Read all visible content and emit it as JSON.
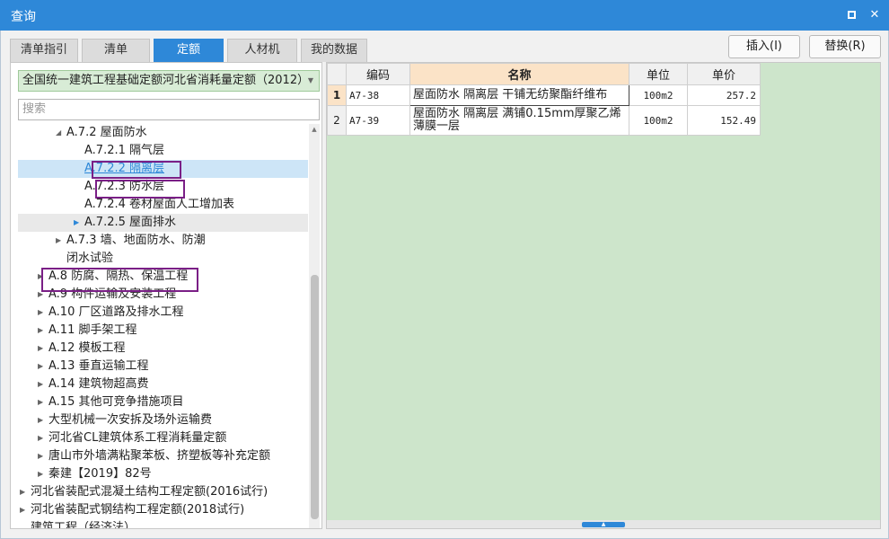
{
  "window": {
    "title": "查询",
    "max_glyph": "□",
    "close_glyph": "✕"
  },
  "tabs": [
    {
      "label": "清单指引"
    },
    {
      "label": "清单"
    },
    {
      "label": "定额",
      "active": true
    },
    {
      "label": "人材机"
    },
    {
      "label": "我的数据"
    }
  ],
  "actions": {
    "insert_label": "插入(I)",
    "replace_label": "替换(R)"
  },
  "left": {
    "library_selected": "全国统一建筑工程基础定额河北省消耗量定额（2012）",
    "search_placeholder": "搜索"
  },
  "tree": [
    {
      "label": "A.7.2 屋面防水",
      "arrow": "◢"
    },
    {
      "label": "A.7.2.1 隔气层",
      "arrow": ""
    },
    {
      "label": "A.7.2.2 隔离层",
      "arrow": "",
      "selected": true
    },
    {
      "label": "A.7.2.3 防水层",
      "arrow": ""
    },
    {
      "label": "A.7.2.4 卷材屋面人工增加表",
      "arrow": ""
    },
    {
      "label": "A.7.2.5 屋面排水",
      "arrow": "▶"
    },
    {
      "label": "A.7.3 墙、地面防水、防潮",
      "arrow": "▶"
    },
    {
      "label": "闭水试验",
      "arrow": ""
    },
    {
      "label": "A.8 防腐、隔热、保温工程",
      "arrow": "▶"
    },
    {
      "label": "A.9 构件运输及安装工程",
      "arrow": "▶"
    },
    {
      "label": "A.10 厂区道路及排水工程",
      "arrow": "▶"
    },
    {
      "label": "A.11 脚手架工程",
      "arrow": "▶"
    },
    {
      "label": "A.12 模板工程",
      "arrow": "▶"
    },
    {
      "label": "A.13 垂直运输工程",
      "arrow": "▶"
    },
    {
      "label": "A.14 建筑物超高费",
      "arrow": "▶"
    },
    {
      "label": "A.15 其他可竞争措施项目",
      "arrow": "▶"
    },
    {
      "label": "大型机械一次安拆及场外运输费",
      "arrow": "▶"
    },
    {
      "label": "河北省CL建筑体系工程消耗量定额",
      "arrow": "▶"
    },
    {
      "label": "唐山市外墙满粘聚苯板、挤塑板等补充定额",
      "arrow": "▶"
    },
    {
      "label": "秦建【2019】82号",
      "arrow": "▶"
    },
    {
      "label": "河北省装配式混凝土结构工程定额(2016试行)",
      "arrow": "▶"
    },
    {
      "label": "河北省装配式钢结构工程定额(2018试行)",
      "arrow": "▶"
    },
    {
      "label": "建筑工程（经济法）",
      "arrow": ""
    }
  ],
  "grid": {
    "headers": {
      "code": "编码",
      "name": "名称",
      "unit": "单位",
      "price": "单价"
    },
    "rows": [
      {
        "num": "1",
        "code": "A7-38",
        "name": "屋面防水 隔离层 干铺无纺聚酯纤维布",
        "unit": "100m2",
        "price": "257.2"
      },
      {
        "num": "2",
        "code": "A7-39",
        "name": "屋面防水 隔离层 满铺0.15mm厚聚乙烯薄膜一层",
        "unit": "100m2",
        "price": "152.49"
      }
    ]
  },
  "scroll": {
    "up_glyph": "▲",
    "handle_glyph": "▲"
  },
  "colors": {
    "accent": "#2e88d8",
    "highlight": "#7a1f86",
    "grid_bg": "#cde5cb"
  }
}
